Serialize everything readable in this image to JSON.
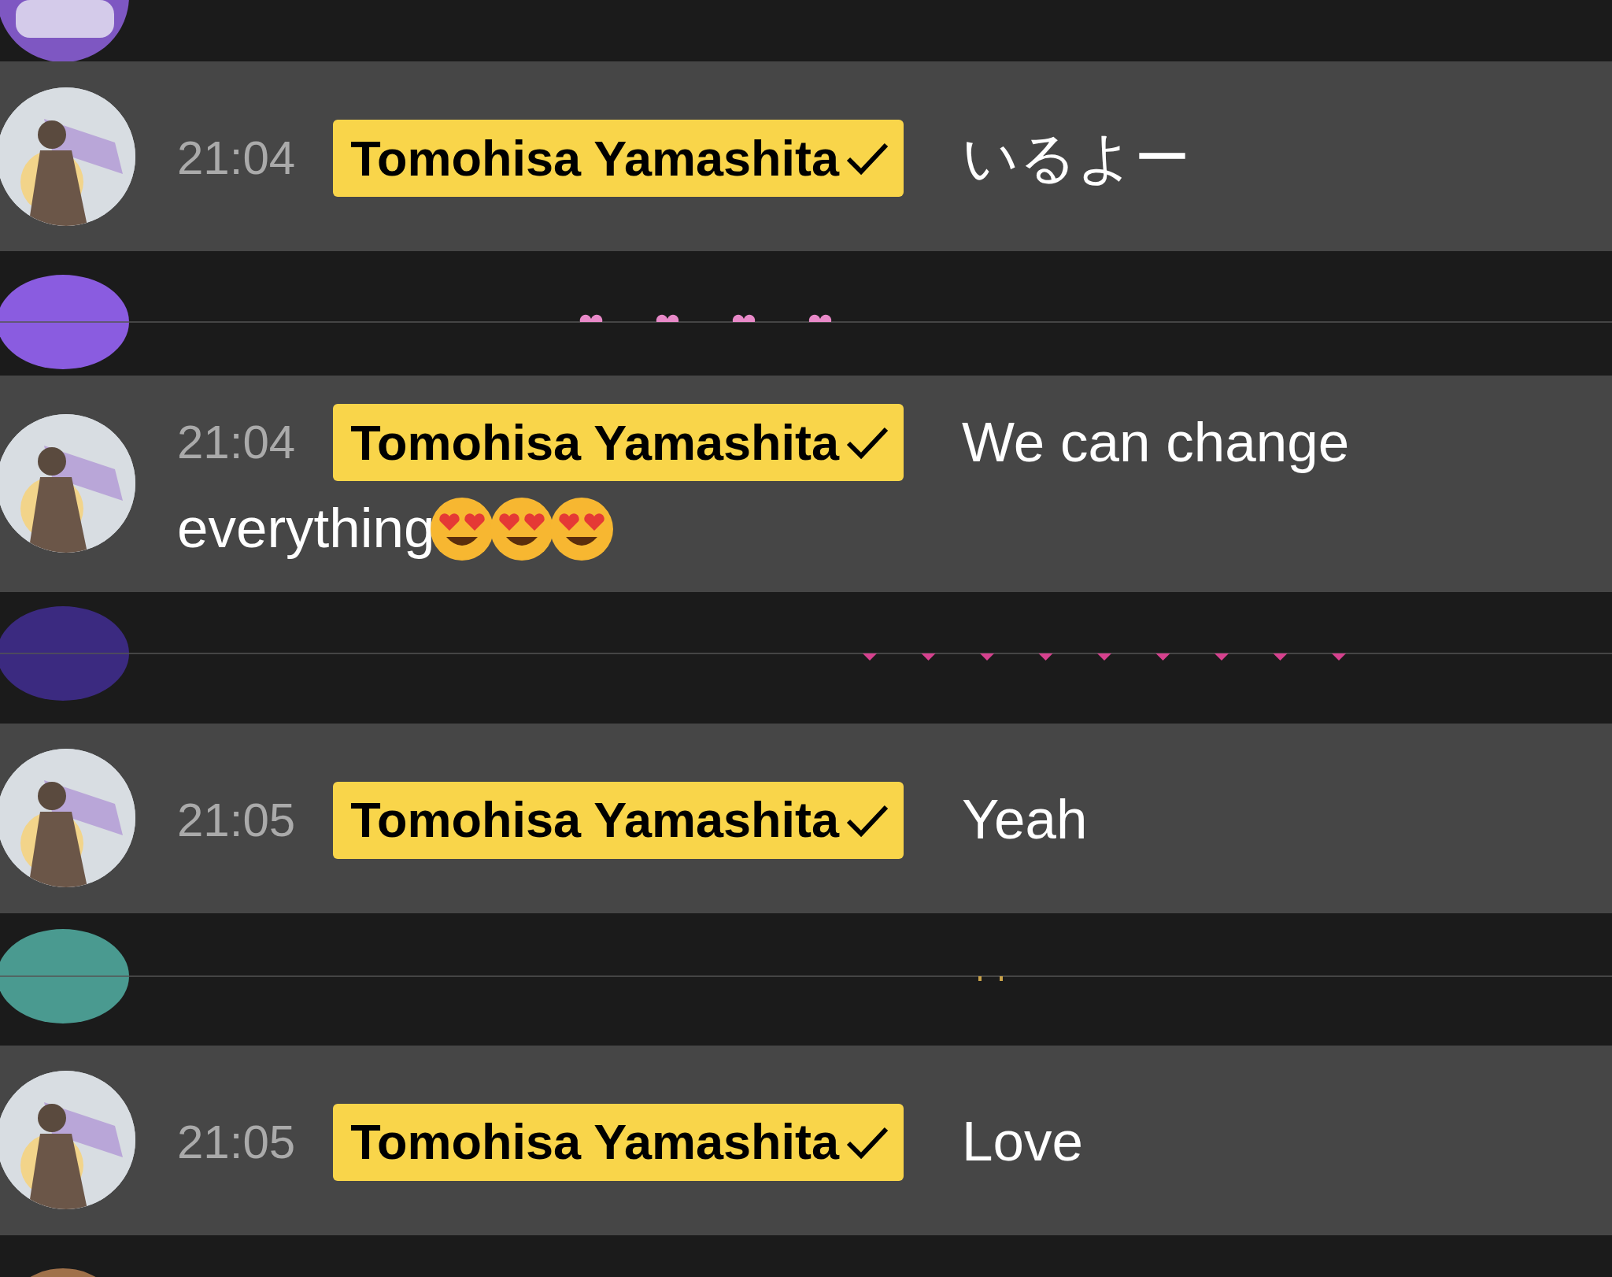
{
  "chat": [
    {
      "kind": "cut_top",
      "color": "#7e57c2"
    },
    {
      "kind": "message",
      "time": "21:04",
      "author": "Tomohisa Yamashita",
      "verified": true,
      "text_lines": [
        "いるよー"
      ]
    },
    {
      "kind": "collapsed",
      "color": "#8a5ce0",
      "fragments": [
        {
          "kind": "heart"
        },
        {
          "kind": "heart"
        },
        {
          "kind": "heart"
        },
        {
          "kind": "heart"
        }
      ]
    },
    {
      "kind": "message",
      "time": "21:04",
      "author": "Tomohisa Yamashita",
      "verified": true,
      "text_lines": [
        "We can change",
        "everything"
      ],
      "emojis": [
        {
          "kind": "heart_eyes"
        },
        {
          "kind": "heart_eyes"
        },
        {
          "kind": "heart_eyes"
        }
      ]
    },
    {
      "kind": "collapsed",
      "color": "#3b2a80",
      "fragments": [
        {
          "kind": "triangle"
        },
        {
          "kind": "triangle"
        },
        {
          "kind": "triangle"
        },
        {
          "kind": "triangle"
        },
        {
          "kind": "triangle"
        },
        {
          "kind": "triangle"
        },
        {
          "kind": "triangle"
        },
        {
          "kind": "triangle"
        },
        {
          "kind": "triangle"
        }
      ]
    },
    {
      "kind": "message",
      "time": "21:05",
      "author": "Tomohisa Yamashita",
      "verified": true,
      "text_lines": [
        "Yeah"
      ]
    },
    {
      "kind": "collapsed",
      "color": "#4a9a90",
      "fragments": [
        {
          "kind": "dot"
        },
        {
          "kind": "dot"
        }
      ]
    },
    {
      "kind": "message",
      "time": "21:05",
      "author": "Tomohisa Yamashita",
      "verified": true,
      "text_lines": [
        "Love"
      ]
    },
    {
      "kind": "cut_bottom",
      "color": "#a0714a"
    }
  ]
}
